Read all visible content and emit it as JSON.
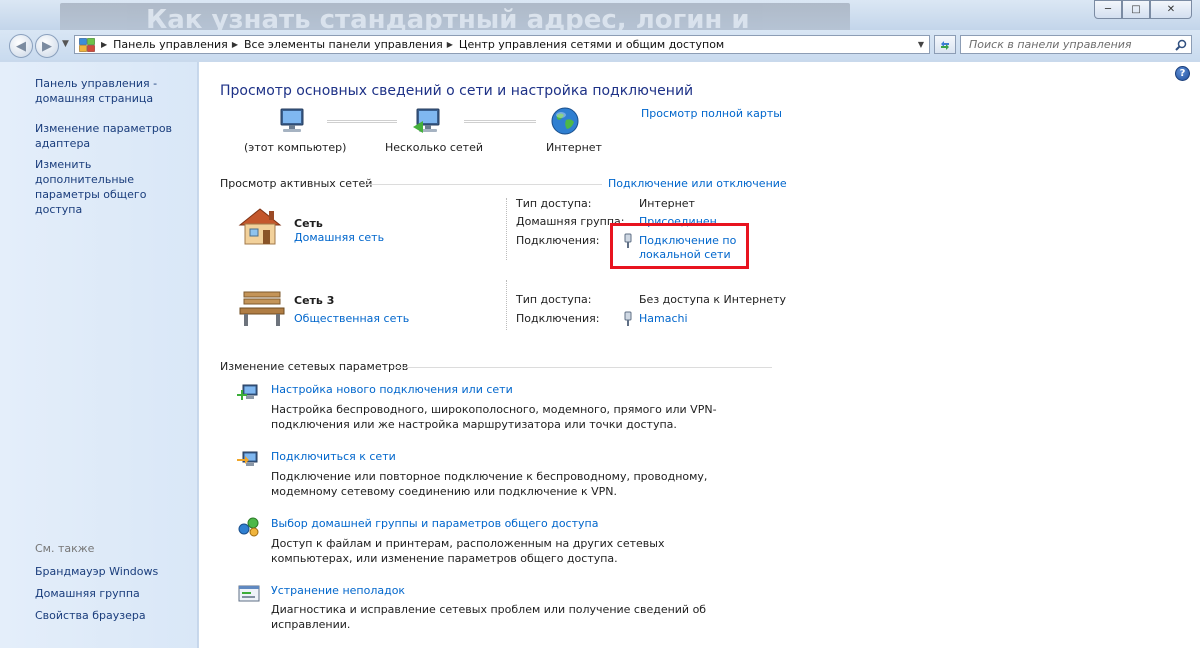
{
  "window": {
    "ghost_title": "Как узнать стандартный адрес, логин и",
    "buttons": {
      "minimize": "─",
      "maximize": "□",
      "close": "✕"
    }
  },
  "address_bar": {
    "crumbs": [
      "Панель управления",
      "Все элементы панели управления",
      "Центр управления сетями и общим доступом"
    ]
  },
  "search": {
    "placeholder": "Поиск в панели управления"
  },
  "sidebar": {
    "links": [
      "Панель управления - домашняя страница",
      "Изменение параметров адаптера",
      "Изменить дополнительные параметры общего доступа"
    ],
    "see_also_title": "См. также",
    "see_also": [
      "Брандмауэр Windows",
      "Домашняя группа",
      "Свойства браузера"
    ]
  },
  "main": {
    "title": "Просмотр основных сведений о сети и настройка подключений",
    "full_map_link": "Просмотр полной карты",
    "map_nodes": [
      "(этот компьютер)",
      "Несколько сетей",
      "Интернет"
    ],
    "active_networks_title": "Просмотр активных сетей",
    "connect_disconnect_link": "Подключение или отключение",
    "networks": [
      {
        "name": "Сеть",
        "type_link": "Домашняя сеть",
        "access_label": "Тип доступа:",
        "access_value": "Интернет",
        "homegroup_label": "Домашняя группа:",
        "homegroup_value": "Присоединен",
        "connections_label": "Подключения:",
        "connection_link": "Подключение по локальной сети"
      },
      {
        "name": "Сеть  3",
        "type_link": "Общественная сеть",
        "access_label": "Тип доступа:",
        "access_value": "Без доступа к Интернету",
        "connections_label": "Подключения:",
        "connection_link": "Hamachi"
      }
    ],
    "change_settings_title": "Изменение сетевых параметров",
    "tasks": [
      {
        "title": "Настройка нового подключения или сети",
        "desc": "Настройка беспроводного, широкополосного, модемного, прямого или VPN-подключения или же настройка маршрутизатора или точки доступа."
      },
      {
        "title": "Подключиться к сети",
        "desc": "Подключение или повторное подключение к беспроводному, проводному, модемному сетевому соединению или подключение к VPN."
      },
      {
        "title": "Выбор домашней группы и параметров общего доступа",
        "desc": "Доступ к файлам и принтерам, расположенным на других сетевых компьютерах, или изменение параметров общего доступа."
      },
      {
        "title": "Устранение неполадок",
        "desc": "Диагностика и исправление сетевых проблем или получение сведений об исправлении."
      }
    ]
  },
  "colors": {
    "link": "#0066cc",
    "title": "#1e3287",
    "highlight": "#e8131f",
    "sidebar_link": "#1a3d7c"
  }
}
